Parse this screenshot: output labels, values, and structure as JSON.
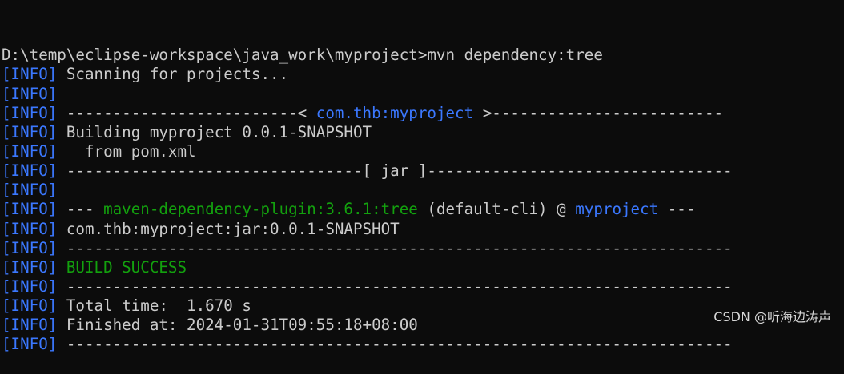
{
  "terminal": {
    "colors": {
      "background": "#0c0c0c",
      "foreground": "#cccccc",
      "info": "#3b78ff",
      "highlight_blue": "#3b78ff",
      "success_green": "#13a10e"
    },
    "lines": [
      [
        {
          "text": "D:\\temp\\eclipse-workspace\\java_work\\myproject>mvn dependency:tree",
          "style": "white"
        }
      ],
      [
        {
          "text": "[INFO]",
          "style": "info"
        },
        {
          "text": " Scanning for projects...",
          "style": "white"
        }
      ],
      [
        {
          "text": "[INFO]",
          "style": "info"
        }
      ],
      [
        {
          "text": "[INFO]",
          "style": "info"
        },
        {
          "text": " -------------------------< ",
          "style": "white"
        },
        {
          "text": "com.thb:myproject",
          "style": "blue"
        },
        {
          "text": " >-------------------------",
          "style": "white"
        }
      ],
      [
        {
          "text": "[INFO]",
          "style": "info"
        },
        {
          "text": " Building myproject 0.0.1-SNAPSHOT",
          "style": "white"
        }
      ],
      [
        {
          "text": "[INFO]",
          "style": "info"
        },
        {
          "text": "   from pom.xml",
          "style": "white"
        }
      ],
      [
        {
          "text": "[INFO]",
          "style": "info"
        },
        {
          "text": " --------------------------------[ jar ]---------------------------------",
          "style": "white"
        }
      ],
      [
        {
          "text": "[INFO]",
          "style": "info"
        }
      ],
      [
        {
          "text": "[INFO]",
          "style": "info"
        },
        {
          "text": " --- ",
          "style": "white"
        },
        {
          "text": "maven-dependency-plugin:3.6.1:tree",
          "style": "green"
        },
        {
          "text": " (default-cli) @ ",
          "style": "white"
        },
        {
          "text": "myproject",
          "style": "blue"
        },
        {
          "text": " ---",
          "style": "white"
        }
      ],
      [
        {
          "text": "[INFO]",
          "style": "info"
        },
        {
          "text": " com.thb:myproject:jar:0.0.1-SNAPSHOT",
          "style": "white"
        }
      ],
      [
        {
          "text": "[INFO]",
          "style": "info"
        },
        {
          "text": " ------------------------------------------------------------------------",
          "style": "white"
        }
      ],
      [
        {
          "text": "[INFO]",
          "style": "info"
        },
        {
          "text": " BUILD SUCCESS",
          "style": "green"
        }
      ],
      [
        {
          "text": "[INFO]",
          "style": "info"
        },
        {
          "text": " ------------------------------------------------------------------------",
          "style": "white"
        }
      ],
      [
        {
          "text": "[INFO]",
          "style": "info"
        },
        {
          "text": " Total time:  1.670 s",
          "style": "white"
        }
      ],
      [
        {
          "text": "[INFO]",
          "style": "info"
        },
        {
          "text": " Finished at: 2024-01-31T09:55:18+08:00",
          "style": "white"
        }
      ],
      [
        {
          "text": "[INFO]",
          "style": "info"
        },
        {
          "text": " ------------------------------------------------------------------------",
          "style": "white"
        }
      ]
    ]
  },
  "watermark": "CSDN @听海边涛声"
}
